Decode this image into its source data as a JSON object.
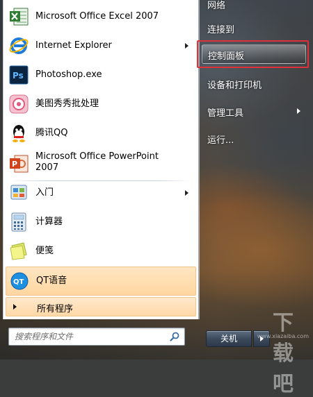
{
  "start_menu": {
    "programs": [
      {
        "label": "Microsoft Office Excel 2007",
        "icon": "excel-icon",
        "has_submenu": true
      },
      {
        "label": "Internet Explorer",
        "icon": "ie-icon",
        "has_submenu": true
      },
      {
        "label": "Photoshop.exe",
        "icon": "photoshop-icon",
        "has_submenu": false
      },
      {
        "label": "美图秀秀批处理",
        "icon": "meitu-icon",
        "has_submenu": false
      },
      {
        "label": "腾讯QQ",
        "icon": "qq-icon",
        "has_submenu": false
      },
      {
        "label_line1": "Microsoft Office PowerPoint",
        "label_line2": "2007",
        "icon": "powerpoint-icon",
        "has_submenu": false
      },
      {
        "label": "入门",
        "icon": "getting-started-icon",
        "has_submenu": true
      },
      {
        "label": "计算器",
        "icon": "calculator-icon",
        "has_submenu": false
      },
      {
        "label": "便笺",
        "icon": "sticky-notes-icon",
        "has_submenu": false
      },
      {
        "label": "QT语音",
        "icon": "qt-voice-icon",
        "has_submenu": false,
        "highlighted": true
      }
    ],
    "all_programs_label": "所有程序",
    "search": {
      "placeholder": "搜索程序和文件"
    },
    "right_column": [
      {
        "label": "网络",
        "has_submenu": false
      },
      {
        "label": "连接到",
        "has_submenu": false
      },
      {
        "label": "控制面板",
        "has_submenu": false,
        "highlighted": true
      },
      {
        "label": "设备和打印机",
        "has_submenu": false
      },
      {
        "label": "管理工具",
        "has_submenu": true
      },
      {
        "label": "运行...",
        "has_submenu": false
      }
    ],
    "shutdown_label": "关机",
    "annotation_color": "#e0303a",
    "highlight_color": "#ffd6a0"
  },
  "watermark": {
    "text": "下载吧",
    "url": "www.xiazaiba.com"
  }
}
